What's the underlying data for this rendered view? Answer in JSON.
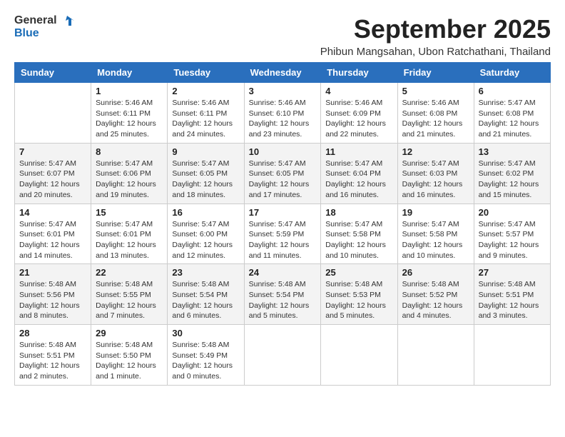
{
  "logo": {
    "line1": "General",
    "line2": "Blue"
  },
  "title": "September 2025",
  "subtitle": "Phibun Mangsahan, Ubon Ratchathani, Thailand",
  "headers": [
    "Sunday",
    "Monday",
    "Tuesday",
    "Wednesday",
    "Thursday",
    "Friday",
    "Saturday"
  ],
  "weeks": [
    [
      {
        "day": "",
        "info": ""
      },
      {
        "day": "1",
        "info": "Sunrise: 5:46 AM\nSunset: 6:11 PM\nDaylight: 12 hours\nand 25 minutes."
      },
      {
        "day": "2",
        "info": "Sunrise: 5:46 AM\nSunset: 6:11 PM\nDaylight: 12 hours\nand 24 minutes."
      },
      {
        "day": "3",
        "info": "Sunrise: 5:46 AM\nSunset: 6:10 PM\nDaylight: 12 hours\nand 23 minutes."
      },
      {
        "day": "4",
        "info": "Sunrise: 5:46 AM\nSunset: 6:09 PM\nDaylight: 12 hours\nand 22 minutes."
      },
      {
        "day": "5",
        "info": "Sunrise: 5:46 AM\nSunset: 6:08 PM\nDaylight: 12 hours\nand 21 minutes."
      },
      {
        "day": "6",
        "info": "Sunrise: 5:47 AM\nSunset: 6:08 PM\nDaylight: 12 hours\nand 21 minutes."
      }
    ],
    [
      {
        "day": "7",
        "info": "Sunrise: 5:47 AM\nSunset: 6:07 PM\nDaylight: 12 hours\nand 20 minutes."
      },
      {
        "day": "8",
        "info": "Sunrise: 5:47 AM\nSunset: 6:06 PM\nDaylight: 12 hours\nand 19 minutes."
      },
      {
        "day": "9",
        "info": "Sunrise: 5:47 AM\nSunset: 6:05 PM\nDaylight: 12 hours\nand 18 minutes."
      },
      {
        "day": "10",
        "info": "Sunrise: 5:47 AM\nSunset: 6:05 PM\nDaylight: 12 hours\nand 17 minutes."
      },
      {
        "day": "11",
        "info": "Sunrise: 5:47 AM\nSunset: 6:04 PM\nDaylight: 12 hours\nand 16 minutes."
      },
      {
        "day": "12",
        "info": "Sunrise: 5:47 AM\nSunset: 6:03 PM\nDaylight: 12 hours\nand 16 minutes."
      },
      {
        "day": "13",
        "info": "Sunrise: 5:47 AM\nSunset: 6:02 PM\nDaylight: 12 hours\nand 15 minutes."
      }
    ],
    [
      {
        "day": "14",
        "info": "Sunrise: 5:47 AM\nSunset: 6:01 PM\nDaylight: 12 hours\nand 14 minutes."
      },
      {
        "day": "15",
        "info": "Sunrise: 5:47 AM\nSunset: 6:01 PM\nDaylight: 12 hours\nand 13 minutes."
      },
      {
        "day": "16",
        "info": "Sunrise: 5:47 AM\nSunset: 6:00 PM\nDaylight: 12 hours\nand 12 minutes."
      },
      {
        "day": "17",
        "info": "Sunrise: 5:47 AM\nSunset: 5:59 PM\nDaylight: 12 hours\nand 11 minutes."
      },
      {
        "day": "18",
        "info": "Sunrise: 5:47 AM\nSunset: 5:58 PM\nDaylight: 12 hours\nand 10 minutes."
      },
      {
        "day": "19",
        "info": "Sunrise: 5:47 AM\nSunset: 5:58 PM\nDaylight: 12 hours\nand 10 minutes."
      },
      {
        "day": "20",
        "info": "Sunrise: 5:47 AM\nSunset: 5:57 PM\nDaylight: 12 hours\nand 9 minutes."
      }
    ],
    [
      {
        "day": "21",
        "info": "Sunrise: 5:48 AM\nSunset: 5:56 PM\nDaylight: 12 hours\nand 8 minutes."
      },
      {
        "day": "22",
        "info": "Sunrise: 5:48 AM\nSunset: 5:55 PM\nDaylight: 12 hours\nand 7 minutes."
      },
      {
        "day": "23",
        "info": "Sunrise: 5:48 AM\nSunset: 5:54 PM\nDaylight: 12 hours\nand 6 minutes."
      },
      {
        "day": "24",
        "info": "Sunrise: 5:48 AM\nSunset: 5:54 PM\nDaylight: 12 hours\nand 5 minutes."
      },
      {
        "day": "25",
        "info": "Sunrise: 5:48 AM\nSunset: 5:53 PM\nDaylight: 12 hours\nand 5 minutes."
      },
      {
        "day": "26",
        "info": "Sunrise: 5:48 AM\nSunset: 5:52 PM\nDaylight: 12 hours\nand 4 minutes."
      },
      {
        "day": "27",
        "info": "Sunrise: 5:48 AM\nSunset: 5:51 PM\nDaylight: 12 hours\nand 3 minutes."
      }
    ],
    [
      {
        "day": "28",
        "info": "Sunrise: 5:48 AM\nSunset: 5:51 PM\nDaylight: 12 hours\nand 2 minutes."
      },
      {
        "day": "29",
        "info": "Sunrise: 5:48 AM\nSunset: 5:50 PM\nDaylight: 12 hours\nand 1 minute."
      },
      {
        "day": "30",
        "info": "Sunrise: 5:48 AM\nSunset: 5:49 PM\nDaylight: 12 hours\nand 0 minutes."
      },
      {
        "day": "",
        "info": ""
      },
      {
        "day": "",
        "info": ""
      },
      {
        "day": "",
        "info": ""
      },
      {
        "day": "",
        "info": ""
      }
    ]
  ]
}
